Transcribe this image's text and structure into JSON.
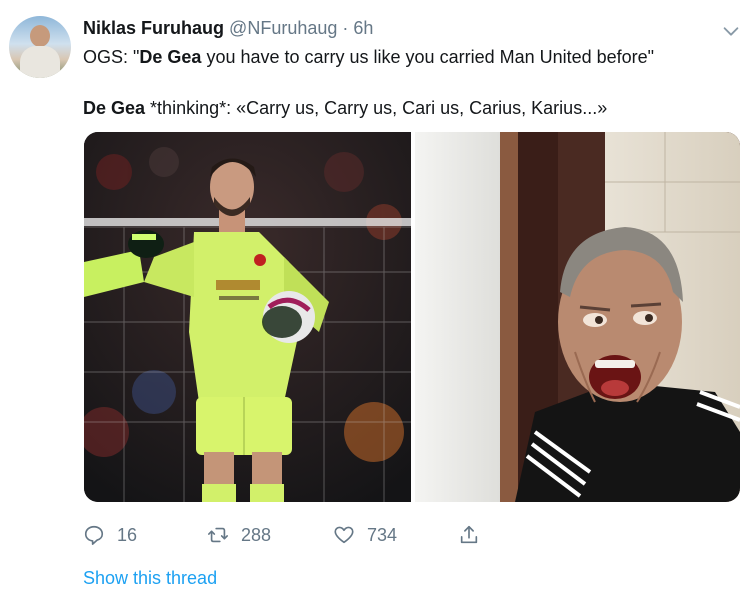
{
  "author": {
    "name": "Niklas Furuhaug",
    "handle": "@NFuruhaug",
    "separator": "·",
    "time": "6h"
  },
  "tweet": {
    "line1": {
      "prefix": "OGS: \"",
      "bold": "De Gea",
      "rest": " you have to carry us like you carried Man United before\""
    },
    "line2": {
      "bold": "De Gea",
      "rest": " *thinking*: «Carry us, Carry us, Cari us, Carius, Karius...»"
    }
  },
  "media": {
    "left_image": "goalkeeper-in-neon-kit-photo",
    "right_image": "man-laughing-photo"
  },
  "actions": {
    "replies": "16",
    "retweets": "288",
    "likes": "734"
  },
  "show_thread_label": "Show this thread",
  "colors": {
    "link": "#1da1f2",
    "muted": "#657786",
    "text": "#14171a"
  },
  "icons": [
    "chevron-down-icon",
    "reply-icon",
    "retweet-icon",
    "like-icon",
    "share-icon"
  ]
}
